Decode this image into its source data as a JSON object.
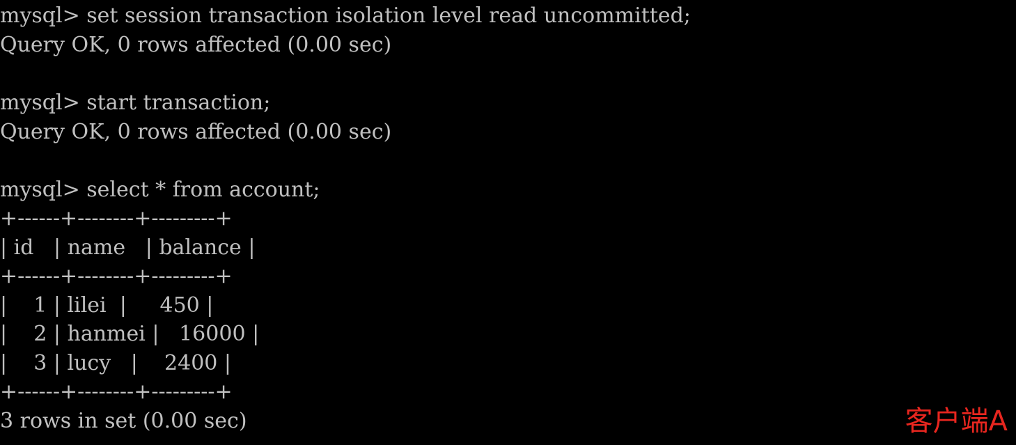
{
  "terminal": {
    "lines": [
      "mysql> set session transaction isolation level read uncommitted;",
      "Query OK, 0 rows affected (0.00 sec)",
      "",
      "mysql> start transaction;",
      "Query OK, 0 rows affected (0.00 sec)",
      "",
      "mysql> select * from account;",
      "+------+--------+---------+",
      "| id   | name   | balance |",
      "+------+--------+---------+",
      "|    1 | lilei  |     450 |",
      "|    2 | hanmei |   16000 |",
      "|    3 | lucy   |    2400 |",
      "+------+--------+---------+",
      "3 rows in set (0.00 sec)"
    ]
  },
  "result_table": {
    "columns": [
      "id",
      "name",
      "balance"
    ],
    "rows": [
      [
        "1",
        "lilei",
        "450"
      ],
      [
        "2",
        "hanmei",
        "16000"
      ],
      [
        "3",
        "lucy",
        "2400"
      ]
    ]
  },
  "annotation": {
    "label": "客户端A",
    "color": "#e8261f"
  },
  "colors": {
    "background": "#000000",
    "text": "#c0c0c0"
  }
}
